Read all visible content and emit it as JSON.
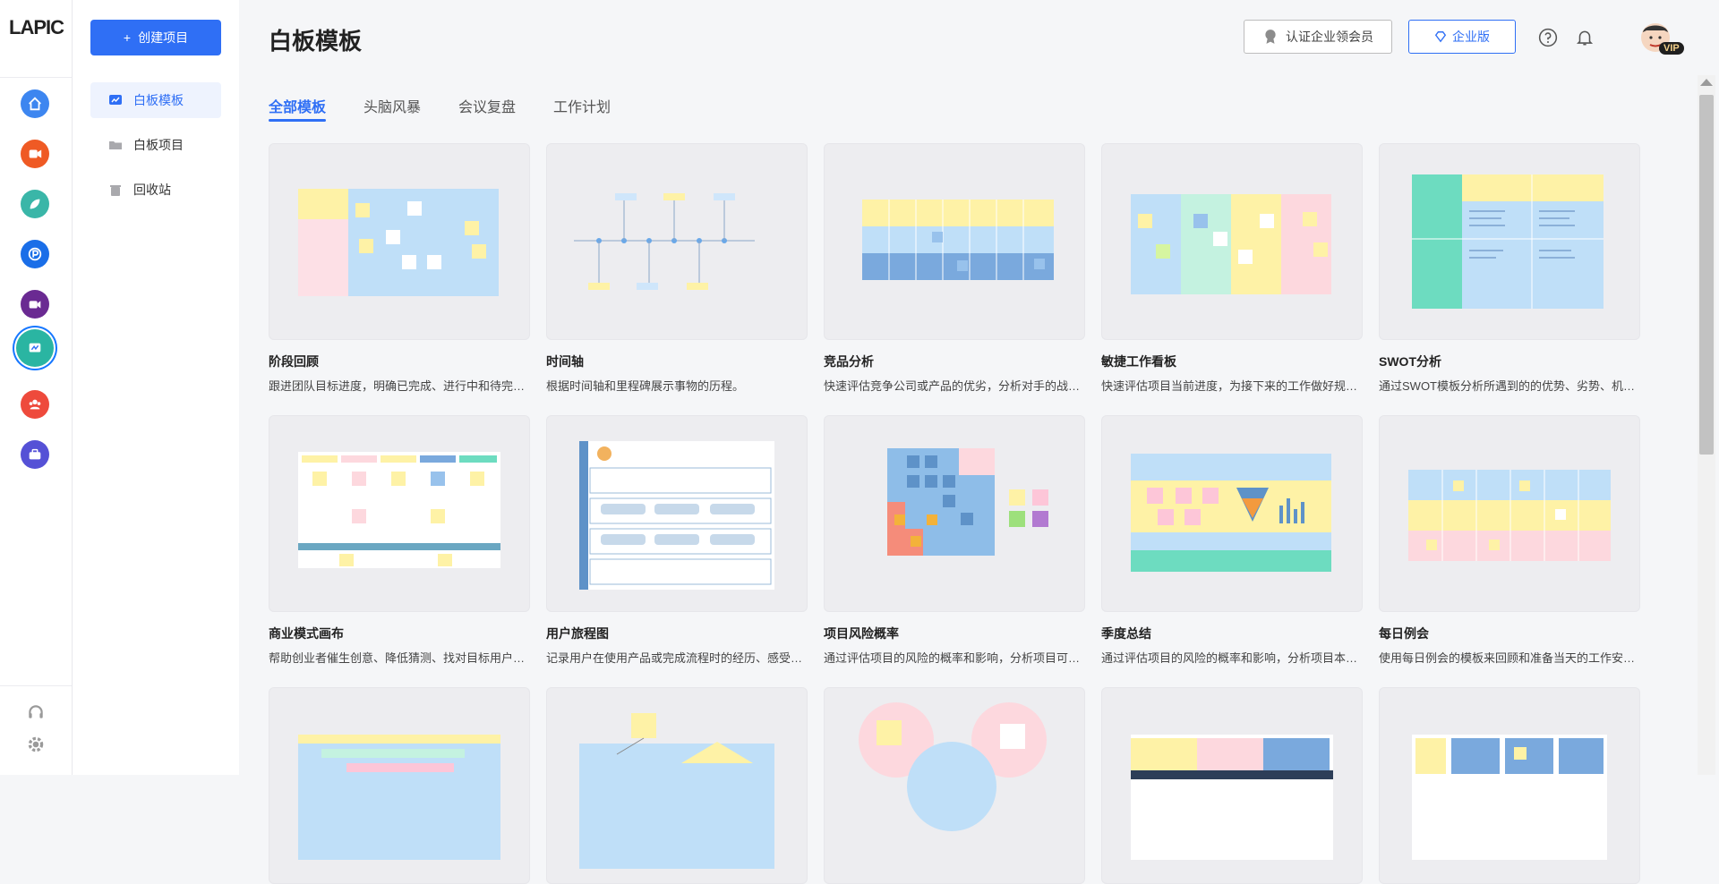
{
  "logo": {
    "text": "LAPIC"
  },
  "colors": {
    "accent": "#2f6ff5",
    "sidebar_active_bg": "#eef3fe"
  },
  "rail": {
    "apps": [
      {
        "name": "home-app",
        "color": "#3d86f0",
        "icon": "home-icon"
      },
      {
        "name": "video-app",
        "color": "#ef5a24",
        "icon": "video-icon"
      },
      {
        "name": "design-app",
        "color": "#3ab6a8",
        "icon": "leaf-icon"
      },
      {
        "name": "p-app",
        "color": "#1a6ee8",
        "icon": "p-icon"
      },
      {
        "name": "media-app",
        "color": "#6a2a92",
        "icon": "camera-icon"
      },
      {
        "name": "whiteboard-app",
        "color": "#2ab5a2",
        "icon": "board-icon"
      },
      {
        "name": "team-app",
        "color": "#ee4a3c",
        "icon": "team-icon"
      },
      {
        "name": "toolbox-app",
        "color": "#5551d6",
        "icon": "briefcase-icon"
      }
    ],
    "bottom": [
      "headset-icon",
      "gear-icon"
    ]
  },
  "sidebar": {
    "create_label": "创建项目",
    "items": [
      {
        "label": "白板模板",
        "icon": "whiteboard-icon",
        "active": true
      },
      {
        "label": "白板项目",
        "icon": "folder-icon",
        "active": false
      },
      {
        "label": "回收站",
        "icon": "trash-icon",
        "active": false
      }
    ]
  },
  "header": {
    "title": "白板模板",
    "verify_label": "认证企业领会员",
    "enterprise_label": "企业版",
    "avatar_badge": "VIP"
  },
  "tabs": [
    {
      "label": "全部模板",
      "active": true
    },
    {
      "label": "头脑风暴",
      "active": false
    },
    {
      "label": "会议复盘",
      "active": false
    },
    {
      "label": "工作计划",
      "active": false
    }
  ],
  "templates": [
    {
      "title": "阶段回顾",
      "desc": "跟进团队目标进度，明确已完成、进行中和待完成的工作内容"
    },
    {
      "title": "时间轴",
      "desc": "根据时间轴和里程碑展示事物的历程。"
    },
    {
      "title": "竞品分析",
      "desc": "快速评估竞争公司或产品的优劣，分析对手的战略与产品特点"
    },
    {
      "title": "敏捷工作看板",
      "desc": "快速评估项目当前进度，为接下来的工作做好规划与安排"
    },
    {
      "title": "SWOT分析",
      "desc": "通过SWOT模板分析所遇到的的优势、劣势、机会和威胁"
    },
    {
      "title": "商业模式画布",
      "desc": "帮助创业者催生创意、降低猜测、找对目标用户、合理解决问题"
    },
    {
      "title": "用户旅程图",
      "desc": "记录用户在使用产品或完成流程时的经历、感受与痛点"
    },
    {
      "title": "项目风险概率",
      "desc": "通过评估项目的风险的概率和影响，分析项目可能面临的问题"
    },
    {
      "title": "季度总结",
      "desc": "通过评估项目的风险的概率和影响，分析项目本季度的完成情况"
    },
    {
      "title": "每日例会",
      "desc": "使用每日例会的模板来回顾和准备当天的工作安排与计划"
    }
  ]
}
